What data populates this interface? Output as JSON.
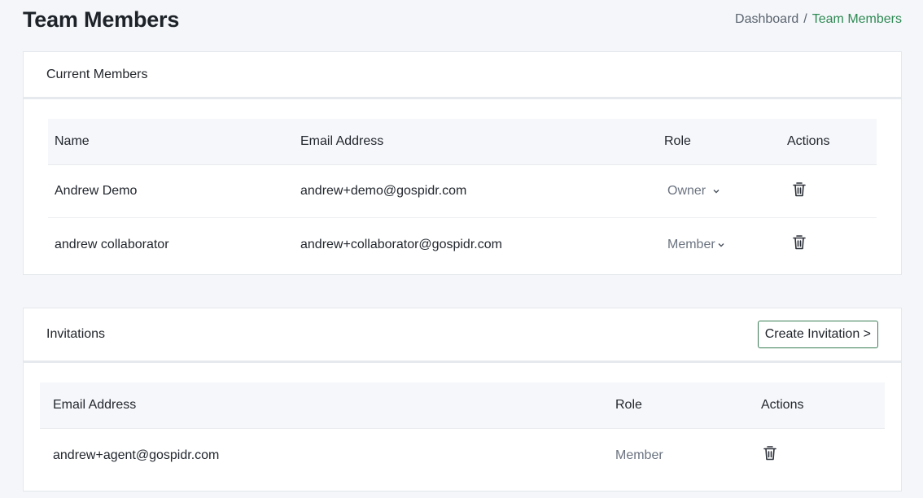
{
  "page": {
    "title": "Team Members"
  },
  "breadcrumb": {
    "home": "Dashboard",
    "separator": "/",
    "current": "Team Members"
  },
  "members": {
    "title": "Current Members",
    "headers": {
      "name": "Name",
      "email": "Email Address",
      "role": "Role",
      "actions": "Actions"
    },
    "rows": [
      {
        "name": "Andrew Demo",
        "email": "andrew+demo@gospidr.com",
        "role": "Owner"
      },
      {
        "name": "andrew collaborator",
        "email": "andrew+collaborator@gospidr.com",
        "role": "Member"
      }
    ]
  },
  "invitations": {
    "title": "Invitations",
    "create_label": "Create Invitation >",
    "headers": {
      "email": "Email Address",
      "role": "Role",
      "actions": "Actions"
    },
    "rows": [
      {
        "email": "andrew+agent@gospidr.com",
        "role": "Member"
      }
    ]
  },
  "colors": {
    "accent": "#2f8a54",
    "button_border": "#3a7d55"
  }
}
